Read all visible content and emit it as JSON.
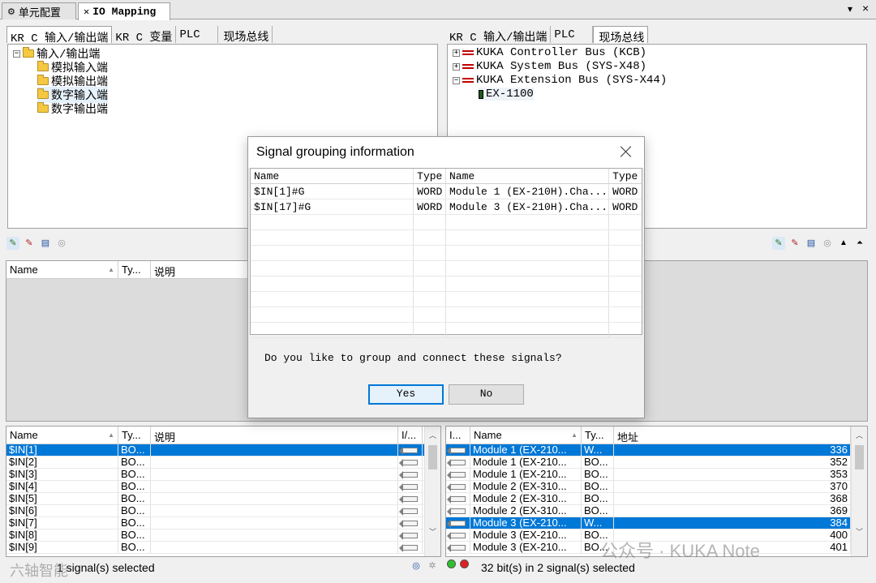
{
  "doc_tabs": {
    "cell_config": "单元配置",
    "io_mapping": "IO Mapping"
  },
  "window_controls": {
    "dropdown": "▾",
    "close": "×"
  },
  "left_pane": {
    "tabs": [
      "KR C 输入/输出端",
      "KR C 变量",
      "PLC",
      "现场总线"
    ],
    "tree": {
      "root": "输入/输出端",
      "children": [
        "模拟输入端",
        "模拟输出端",
        "数字输入端",
        "数字输出端"
      ]
    },
    "upper_grid": {
      "columns": [
        "Name",
        "Ty...",
        "说明"
      ]
    },
    "lower_grid": {
      "columns": [
        "Name",
        "Ty...",
        "说明",
        "I/..."
      ],
      "rows": [
        {
          "name": "$IN[1]",
          "type": "BO...",
          "desc": "",
          "selected": true
        },
        {
          "name": "$IN[2]",
          "type": "BO...",
          "desc": "",
          "selected": false
        },
        {
          "name": "$IN[3]",
          "type": "BO...",
          "desc": "",
          "selected": false
        },
        {
          "name": "$IN[4]",
          "type": "BO...",
          "desc": "",
          "selected": false
        },
        {
          "name": "$IN[5]",
          "type": "BO...",
          "desc": "",
          "selected": false
        },
        {
          "name": "$IN[6]",
          "type": "BO...",
          "desc": "",
          "selected": false
        },
        {
          "name": "$IN[7]",
          "type": "BO...",
          "desc": "",
          "selected": false
        },
        {
          "name": "$IN[8]",
          "type": "BO...",
          "desc": "",
          "selected": false
        },
        {
          "name": "$IN[9]",
          "type": "BO...",
          "desc": "",
          "selected": false
        }
      ]
    },
    "status": "1 signal(s) selected"
  },
  "right_pane": {
    "tabs": [
      "KR C 输入/输出端",
      "PLC",
      "现场总线"
    ],
    "tree": [
      "KUKA Controller Bus (KCB)",
      "KUKA System Bus (SYS-X48)",
      "KUKA Extension Bus (SYS-X44)",
      "EX-1100"
    ],
    "lower_grid": {
      "columns": [
        "I...",
        "Name",
        "Ty...",
        "地址"
      ],
      "rows": [
        {
          "name": "Module 1 (EX-210...",
          "type": "W...",
          "addr": "336",
          "selected": true
        },
        {
          "name": "Module 1 (EX-210...",
          "type": "BO...",
          "addr": "352",
          "selected": false
        },
        {
          "name": "Module 1 (EX-210...",
          "type": "BO...",
          "addr": "353",
          "selected": false
        },
        {
          "name": "Module 2 (EX-310...",
          "type": "BO...",
          "addr": "370",
          "selected": false
        },
        {
          "name": "Module 2 (EX-310...",
          "type": "BO...",
          "addr": "368",
          "selected": false
        },
        {
          "name": "Module 2 (EX-310...",
          "type": "BO...",
          "addr": "369",
          "selected": false
        },
        {
          "name": "Module 3 (EX-210...",
          "type": "W...",
          "addr": "384",
          "selected": true
        },
        {
          "name": "Module 3 (EX-210...",
          "type": "BO...",
          "addr": "400",
          "selected": false
        },
        {
          "name": "Module 3 (EX-210...",
          "type": "BO...",
          "addr": "401",
          "selected": false
        }
      ]
    },
    "status": "32 bit(s) in 2 signal(s) selected"
  },
  "dialog": {
    "title": "Signal grouping information",
    "columns": [
      "Name",
      "Type",
      "Name",
      "Type"
    ],
    "rows": [
      [
        "$IN[1]#G",
        "WORD",
        "Module 1 (EX-210H).Cha...",
        "WORD"
      ],
      [
        "$IN[17]#G",
        "WORD",
        "Module 3 (EX-210H).Cha...",
        "WORD"
      ]
    ],
    "message": "Do you like to group and connect these signals?",
    "yes": "Yes",
    "no": "No"
  },
  "watermark": {
    "right": "公众号 · KUKA Note",
    "left": "六轴智能"
  },
  "colors": {
    "selection": "#0078d7",
    "bus": "#c00000",
    "folder": "#f5c842"
  }
}
